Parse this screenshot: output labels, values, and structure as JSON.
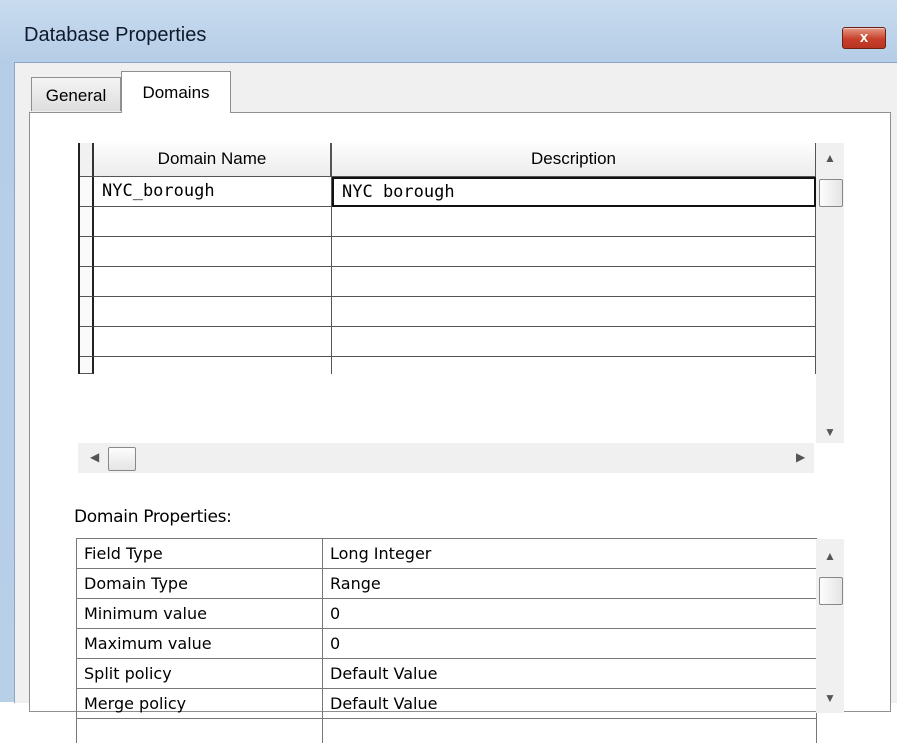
{
  "window": {
    "title": "Database Properties",
    "close_label": "x"
  },
  "tabs": [
    {
      "label": "General",
      "selected": false
    },
    {
      "label": "Domains",
      "selected": true
    }
  ],
  "domains_grid": {
    "columns": [
      "Domain Name",
      "Description"
    ],
    "rows": [
      {
        "name": "NYC_borough",
        "description": "NYC borough"
      },
      {
        "name": "",
        "description": ""
      },
      {
        "name": "",
        "description": ""
      },
      {
        "name": "",
        "description": ""
      },
      {
        "name": "",
        "description": ""
      },
      {
        "name": "",
        "description": ""
      },
      {
        "name": "",
        "description": ""
      }
    ]
  },
  "domain_properties": {
    "label": "Domain Properties:",
    "rows": [
      {
        "property": "Field Type",
        "value": "Long Integer"
      },
      {
        "property": "Domain Type",
        "value": "Range"
      },
      {
        "property": "Minimum value",
        "value": "0"
      },
      {
        "property": "Maximum value",
        "value": "0"
      },
      {
        "property": "Split policy",
        "value": "Default Value"
      },
      {
        "property": "Merge policy",
        "value": "Default Value"
      },
      {
        "property": "",
        "value": ""
      }
    ]
  },
  "colors": {
    "titlebar": "#bcd2ea",
    "close_button": "#c8402a"
  }
}
